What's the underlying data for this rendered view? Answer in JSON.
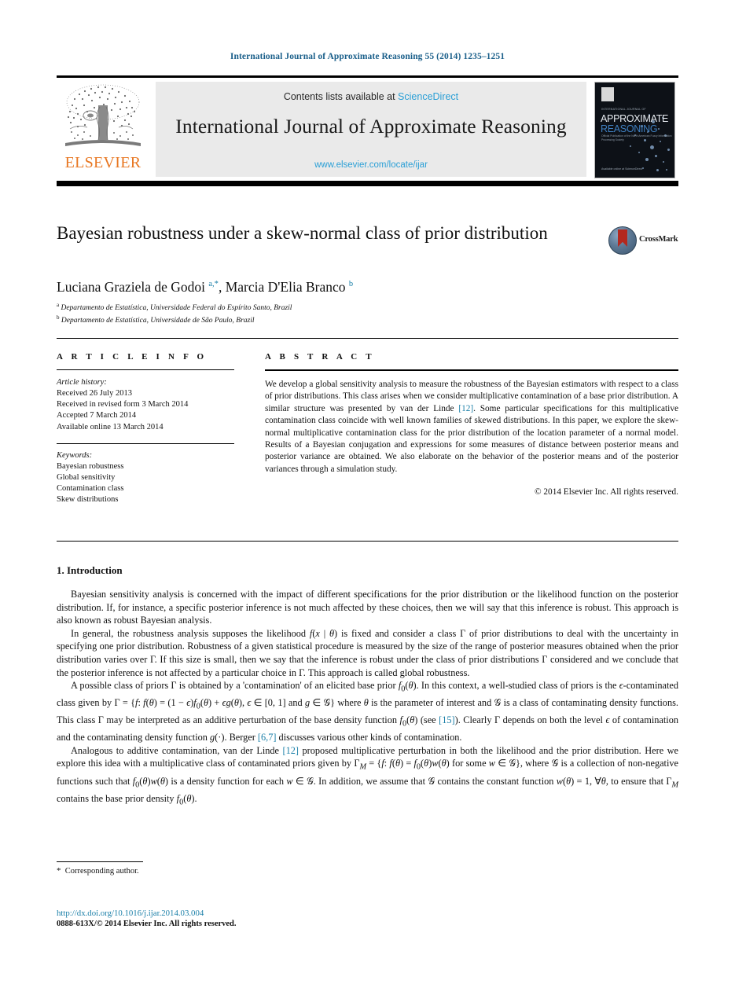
{
  "running_head": "International Journal of Approximate Reasoning 55 (2014) 1235–1251",
  "masthead": {
    "publisher_name": "ELSEVIER",
    "contents_prefix": "Contents lists available at ",
    "contents_link": "ScienceDirect",
    "journal_title": "International Journal of Approximate Reasoning",
    "journal_url": "www.elsevier.com/locate/ijar",
    "cover": {
      "kicker": "INTERNATIONAL JOURNAL OF",
      "line1": "APPROXIMATE",
      "line2": "REASONING",
      "subtitle": "Official Publication of the North American Fuzzy Information Processing Society",
      "footer": "Available online at\nScienceDirect"
    }
  },
  "article": {
    "title": "Bayesian robustness under a skew-normal class of prior distribution",
    "authors_html": "Luciana Graziela de Godoi <sup>a,*</sup>, Marcia D'Elia Branco <sup>b</sup>",
    "affiliation_a": "Departamento de Estatística, Universidade Federal do Espírito Santo, Brazil",
    "affiliation_b": "Departamento de Estatística, Universidade de São Paulo, Brazil",
    "crossmark_label": "CrossMark"
  },
  "info": {
    "heading": "A R T I C L E   I N F O",
    "history_label": "Article history:",
    "history": [
      "Received 26 July 2013",
      "Received in revised form 3 March 2014",
      "Accepted 7 March 2014",
      "Available online 13 March 2014"
    ],
    "keywords_label": "Keywords:",
    "keywords": [
      "Bayesian robustness",
      "Global sensitivity",
      "Contamination class",
      "Skew distributions"
    ]
  },
  "abstract": {
    "heading": "A B S T R A C T",
    "text_html": "We develop a global sensitivity analysis to measure the robustness of the Bayesian estimators with respect to a class of prior distributions. This class arises when we consider multiplicative contamination of a base prior distribution. A similar structure was presented by van der Linde <span class=\"ref\">[12]</span>. Some particular specifications for this multiplicative contamination class coincide with well known families of skewed distributions. In this paper, we explore the skew-normal multiplicative contamination class for the prior distribution of the location parameter of a normal model. Results of a Bayesian conjugation and expressions for some measures of distance between posterior means and posterior variance are obtained. We also elaborate on the behavior of the posterior means and of the posterior variances through a simulation study.",
    "copyright": "© 2014 Elsevier Inc. All rights reserved."
  },
  "body": {
    "section_title": "1. Introduction",
    "paragraphs_html": [
      "Bayesian sensitivity analysis is concerned with the impact of different specifications for the prior distribution or the likelihood function on the posterior distribution. If, for instance, a specific posterior inference is not much affected by these choices, then we will say that this inference is robust. This approach is also known as robust Bayesian analysis.",
      "In general, the robustness analysis supposes the likelihood <i>f</i>(<i>x</i> | <i>θ</i>) is fixed and consider a class Γ of prior distributions to deal with the uncertainty in specifying one prior distribution. Robustness of a given statistical procedure is measured by the size of the range of posterior measures obtained when the prior distribution varies over Γ. If this size is small, then we say that the inference is robust under the class of prior distributions Γ considered and we conclude that the posterior inference is not affected by a particular choice in Γ. This approach is called global robustness.",
      "A possible class of priors Γ is obtained by a 'contamination' of an elicited base prior <i>f</i><sub>0</sub>(<i>θ</i>). In this context, a well-studied class of priors is the <i>ϵ</i>-contaminated class given by Γ = {<i>f</i>: <i>f</i>(<i>θ</i>) = (1 − <i>ϵ</i>)<i>f</i><sub>0</sub>(<i>θ</i>) + <i>ϵg</i>(<i>θ</i>), <i>ϵ</i> ∈ [0, 1] and <i>g</i> ∈ 𝒢} where <i>θ</i> is the parameter of interest and 𝒢 is a class of contaminating density functions. This class Γ may be interpreted as an additive perturbation of the base density function <i>f</i><sub>0</sub>(<i>θ</i>) (see <span class=\"ref\">[15]</span>). Clearly Γ depends on both the level <i>ϵ</i> of contamination and the contaminating density function <i>g</i>(·). Berger <span class=\"ref\">[6,7]</span> discusses various other kinds of contamination.",
      "Analogous to additive contamination, van der Linde <span class=\"ref\">[12]</span> proposed multiplicative perturbation in both the likelihood and the prior distribution. Here we explore this idea with a multiplicative class of contaminated priors given by Γ<sub><i>M</i></sub> = {<i>f</i>: <i>f</i>(<i>θ</i>) = <i>f</i><sub>0</sub>(<i>θ</i>)<i>w</i>(<i>θ</i>) for some <i>w</i> ∈ 𝒢}, where 𝒢 is a collection of non-negative functions such that <i>f</i><sub>0</sub>(<i>θ</i>)<i>w</i>(<i>θ</i>) is a density function for each <i>w</i> ∈ 𝒢. In addition, we assume that 𝒢 contains the constant function <i>w</i>(<i>θ</i>) = 1, ∀<i>θ</i>, to ensure that Γ<sub><i>M</i></sub> contains the base prior density <i>f</i><sub>0</sub>(<i>θ</i>)."
    ]
  },
  "footer": {
    "corresponding_author": "Corresponding author.",
    "doi": "http://dx.doi.org/10.1016/j.ijar.2014.03.004",
    "issn_copyright": "0888-613X/© 2014 Elsevier Inc. All rights reserved."
  },
  "colors": {
    "link_blue": "#2a9fd6",
    "ref_blue": "#1a7fa8",
    "elsevier_orange": "#e87722",
    "crossmark_red": "#b4281e"
  }
}
